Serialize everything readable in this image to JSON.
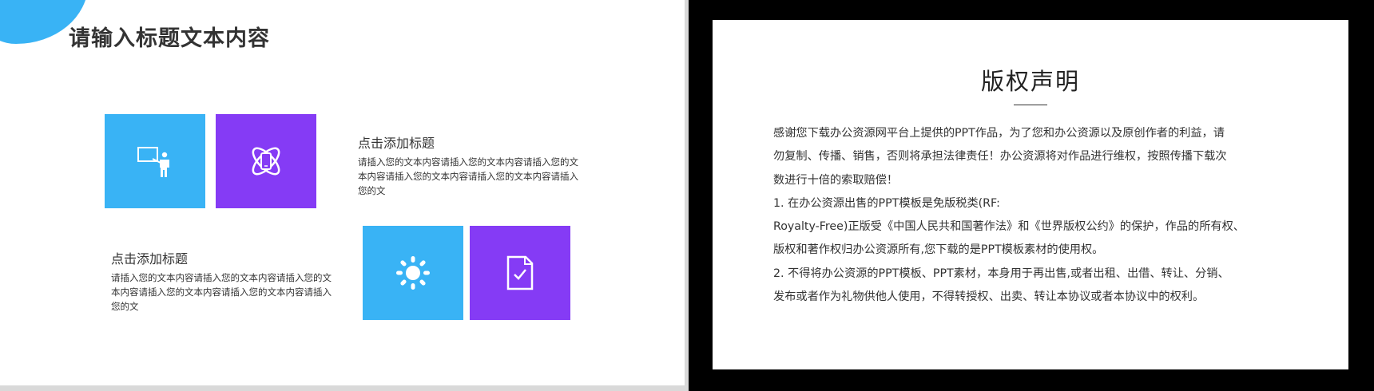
{
  "left_slide": {
    "title": "请输入标题文本内容",
    "colors": {
      "blue": "#39b3f5",
      "purple": "#853bf5"
    },
    "tiles": [
      {
        "icon": "presentation-teacher-icon",
        "color": "blue"
      },
      {
        "icon": "atom-device-icon",
        "color": "purple"
      },
      {
        "icon": "sun-gear-icon",
        "color": "blue"
      },
      {
        "icon": "document-check-icon",
        "color": "purple"
      }
    ],
    "blocks": [
      {
        "heading": "点击添加标题",
        "body": "请插入您的文本内容请插入您的文本内容请插入您的文本内容请插入您的文本内容请插入您的文本内容请插入您的文"
      },
      {
        "heading": "点击添加标题",
        "body": "请插入您的文本内容请插入您的文本内容请插入您的文本内容请插入您的文本内容请插入您的文本内容请插入您的文"
      }
    ]
  },
  "right_slide": {
    "title": "版权声明",
    "lines": [
      "感谢您下载办公资源网平台上提供的PPT作品，为了您和办公资源以及原创作者的利益，请",
      "勿复制、传播、销售，否则将承担法律责任！办公资源将对作品进行维权，按照传播下载次",
      "数进行十倍的索取赔偿！",
      " 1. 在办公资源出售的PPT模板是免版税类(RF:",
      "Royalty-Free)正版受《中国人民共和国著作法》和《世界版权公约》的保护，作品的所有权、",
      "版权和著作权归办公资源所有,您下载的是PPT模板素材的使用权。",
      " 2. 不得将办公资源的PPT模板、PPT素材，本身用于再出售,或者出租、出借、转让、分销、",
      "发布或者作为礼物供他人使用，不得转授权、出卖、转让本协议或者本协议中的权利。"
    ]
  }
}
